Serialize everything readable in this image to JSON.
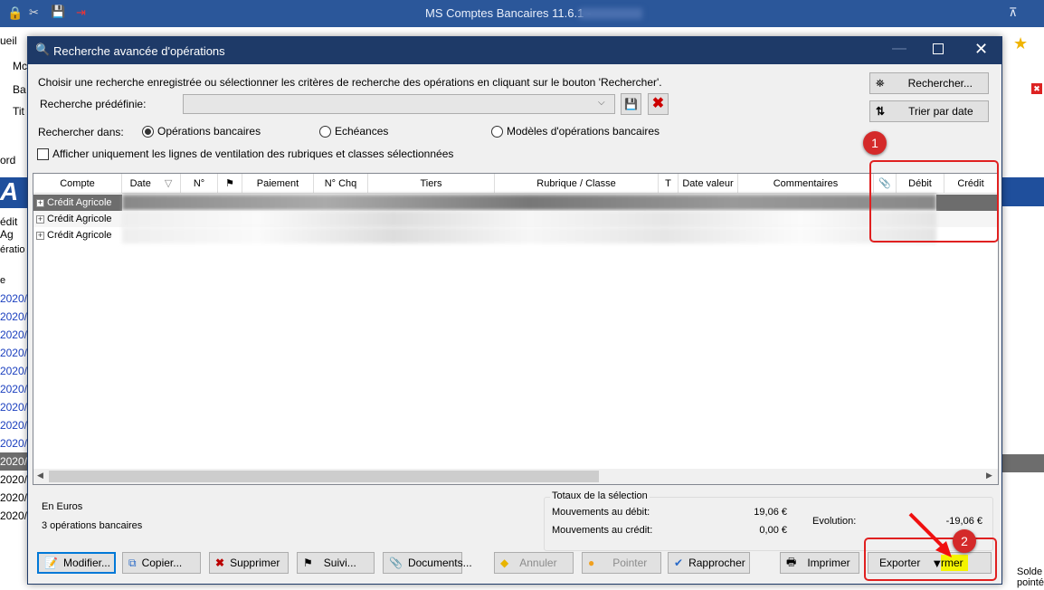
{
  "app": {
    "title": "MS Comptes Bancaires 11.6.1 -",
    "left_labels": [
      "ueil",
      "Mc",
      "Ba",
      "Tit",
      "ord",
      "A",
      "édit Ag",
      "ératio",
      "e"
    ],
    "dates": [
      "/2020",
      "/2020",
      "/2020",
      "/2020",
      "/2020",
      "/2020",
      "/2020",
      "/2020",
      "/2020",
      "/2020",
      "/2020",
      "/2020",
      "/2020"
    ],
    "bottom_right_text": "Solde pointé:"
  },
  "dialog": {
    "title": "Recherche avancée d'opérations",
    "instruction": "Choisir une recherche enregistrée ou sélectionner les critères de recherche des opérations en cliquant sur le bouton 'Rechercher'.",
    "predefined_label": "Recherche prédéfinie:",
    "predefined_value": "",
    "search_in_label": "Rechercher dans:",
    "radios": [
      {
        "label": "Opérations bancaires",
        "checked": true
      },
      {
        "label": "Echéances",
        "checked": false
      },
      {
        "label": "Modèles d'opérations bancaires",
        "checked": false
      }
    ],
    "checkbox_label": "Afficher uniquement les lignes de ventilation des rubriques et classes sélectionnées",
    "search_button": "Rechercher...",
    "sort_button": "Trier par date",
    "columns": [
      "Compte",
      "Date",
      "N°",
      "",
      "Paiement",
      "N° Chq",
      "Tiers",
      "Rubrique / Classe",
      "T",
      "Date valeur",
      "Commentaires",
      "",
      "Débit",
      "Crédit"
    ],
    "rows": [
      {
        "compte": "Crédit Agricole"
      },
      {
        "compte": "Crédit Agricole"
      },
      {
        "compte": "Crédit Agricole"
      }
    ],
    "currency": "En Euros",
    "count": "3 opérations bancaires",
    "totals": {
      "title": "Totaux de la sélection",
      "debit_label": "Mouvements au débit:",
      "debit": "19,06 €",
      "credit_label": "Mouvements au crédit:",
      "credit": "0,00 €",
      "evolution_label": "Evolution:",
      "evolution": "-19,06 €"
    },
    "buttons": {
      "modify": "Modifier...",
      "copy": "Copier...",
      "delete": "Supprimer",
      "follow": "Suivi...",
      "documents": "Documents...",
      "cancel": "Annuler",
      "check": "Pointer",
      "reconcile": "Rapprocher",
      "print": "Imprimer",
      "export": "Exporter",
      "close": "rmer"
    },
    "annotations": [
      "1",
      "2"
    ]
  },
  "colors": {
    "app_title": "#2b579a",
    "dialog_title": "#1e3a68",
    "highlight": "#e02020",
    "selected_row": "#6d6d6d"
  }
}
